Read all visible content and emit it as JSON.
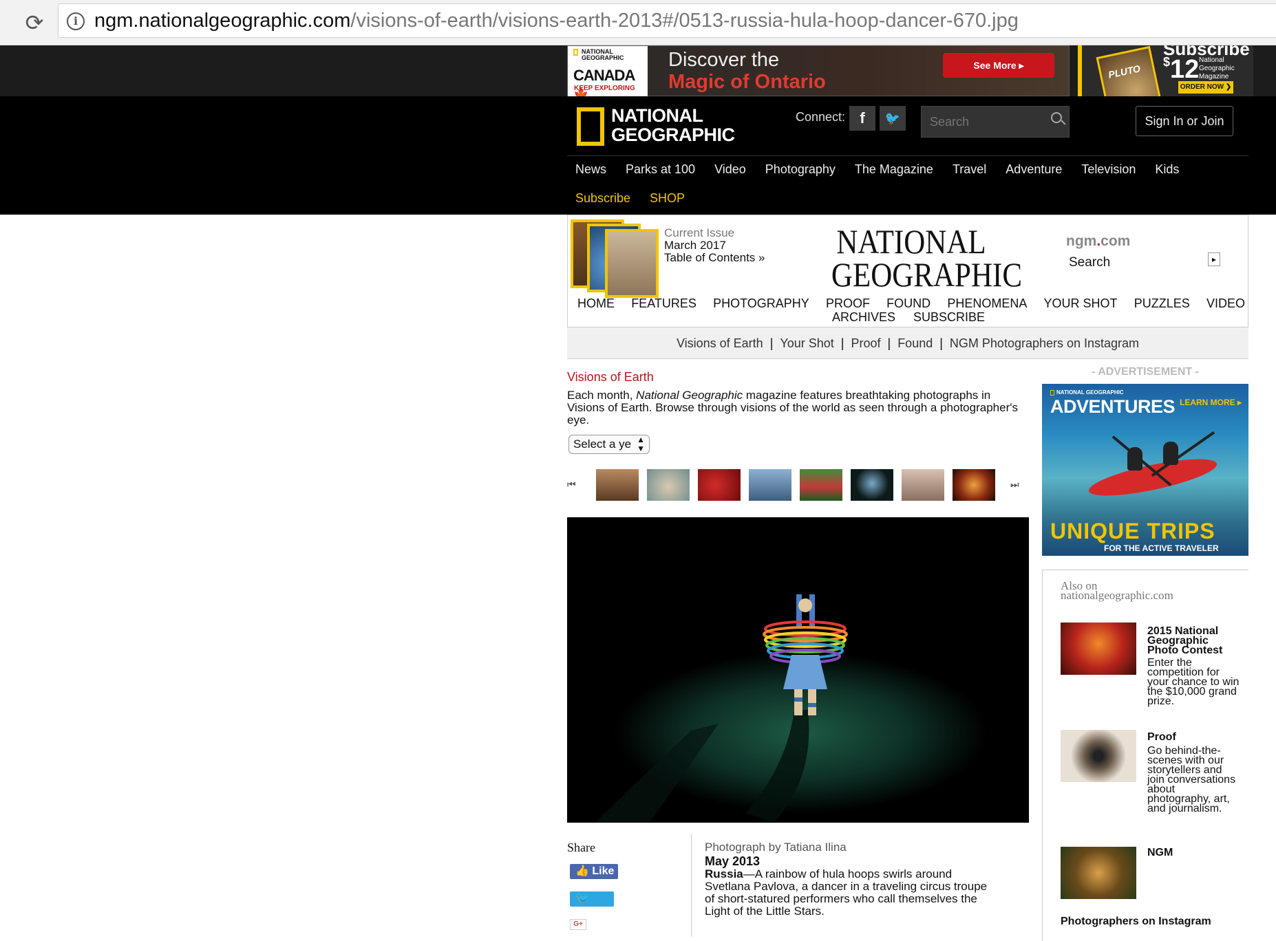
{
  "browser": {
    "url_host": "ngm.nationalgeographic.com",
    "url_path": "/visions-of-earth/visions-earth-2013#/0513-russia-hula-hoop-dancer-670.jpg"
  },
  "ads": {
    "ontario": {
      "brand_small": "NATIONAL GEOGRAPHIC",
      "brand": "CANADA",
      "tagline": "KEEP EXPLORING",
      "line1": "Discover the",
      "line2": "Magic of Ontario",
      "button": "See More ▸"
    },
    "subscribe": {
      "heading": "Subscribe",
      "cover_text": "PLUTO",
      "price": "12",
      "price_symbol": "$",
      "desc1": "National",
      "desc2": "Geographic",
      "desc3": "Magazine",
      "button": "ORDER NOW ❯"
    },
    "adventures": {
      "label": "- ADVERTISEMENT -",
      "brand": "NATIONAL GEOGRAPHIC",
      "title": "ADVENTURES",
      "learn": "LEARN MORE ▸",
      "big": "UNIQUE TRIPS",
      "sub": "FOR THE ACTIVE TRAVELER"
    }
  },
  "header": {
    "logo_line1": "NATIONAL",
    "logo_line2": "GEOGRAPHIC",
    "connect": "Connect:",
    "facebook": "f",
    "twitter": "🐦",
    "search_placeholder": "Search",
    "signin": "Sign In or Join",
    "nav": [
      "News",
      "Parks at 100",
      "Video",
      "Photography",
      "The Magazine",
      "Travel",
      "Adventure",
      "Television",
      "Kids"
    ],
    "subnav": [
      "Subscribe",
      "SHOP"
    ]
  },
  "ngm": {
    "current_issue": "Current Issue",
    "issue_date": "March 2017",
    "toc": "Table of Contents »",
    "title_line1": "NATIONAL",
    "title_line2": "GEOGRAPHIC",
    "site_ngm": "ngm",
    "site_dot": ".",
    "site_com": "com",
    "search_label": "Search",
    "search_btn": "▸",
    "nav": [
      "HOME",
      "FEATURES",
      "PHOTOGRAPHY",
      "PROOF",
      "FOUND",
      "PHENOMENA",
      "YOUR SHOT",
      "PUZZLES",
      "VIDEO"
    ],
    "nav2": [
      "ARCHIVES",
      "SUBSCRIBE"
    ]
  },
  "sections": [
    "Visions of Earth",
    "Your Shot",
    "Proof",
    "Found",
    "NGM Photographers on Instagram"
  ],
  "visions": {
    "title": "Visions of Earth",
    "desc_pre": "Each month, ",
    "desc_em": "National Geographic",
    "desc_post": " magazine features breathtaking photographs in Visions of Earth. Browse through visions of the world as seen through a photographer's eye.",
    "select_value": "Select a ye",
    "prev": "⏮",
    "next": "⏭"
  },
  "share": {
    "label": "Share",
    "like": "👍 Like 4",
    "tweet": "🐦 Tweet",
    "gplus": "G+"
  },
  "caption": {
    "credit": "Photograph by Tatiana Ilina",
    "date": "May 2013",
    "place": "Russia",
    "text": "—A rainbow of hula hoops swirls around Svetlana Pavlova, a dancer in a traveling circus troupe of short-statured performers who call themselves the Light of the Little Stars."
  },
  "also": {
    "title1": "Also on",
    "title2": "nationalgeographic.com",
    "items": [
      {
        "title": "2015 National Geographic Photo Contest",
        "text": "Enter the competition for your chance to win the $10,000 grand prize."
      },
      {
        "title": "Proof",
        "text": "Go behind-the-scenes with our storytellers and join conversations about photography, art, and journalism."
      },
      {
        "title": "NGM",
        "text": "Photographers on Instagram"
      }
    ]
  },
  "colors": {
    "accent_yellow": "#f2c500",
    "accent_red": "#b8141c"
  }
}
